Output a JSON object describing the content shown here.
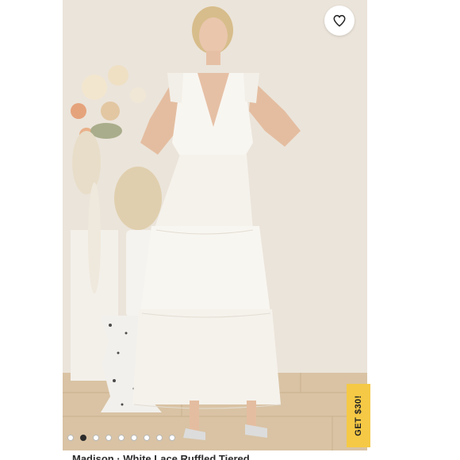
{
  "product": {
    "title_partial": "Madison · White Lace Ruffled Tiered"
  },
  "favorite": {
    "icon": "heart-icon",
    "active": false
  },
  "promo": {
    "label": "GET $30!",
    "color": "#f5c945"
  },
  "carousel": {
    "dot_count": 9,
    "active_index": 1
  },
  "colors": {
    "background": "#ece6dc",
    "dress": "#f8f6f1",
    "accent": "#f5c945"
  }
}
